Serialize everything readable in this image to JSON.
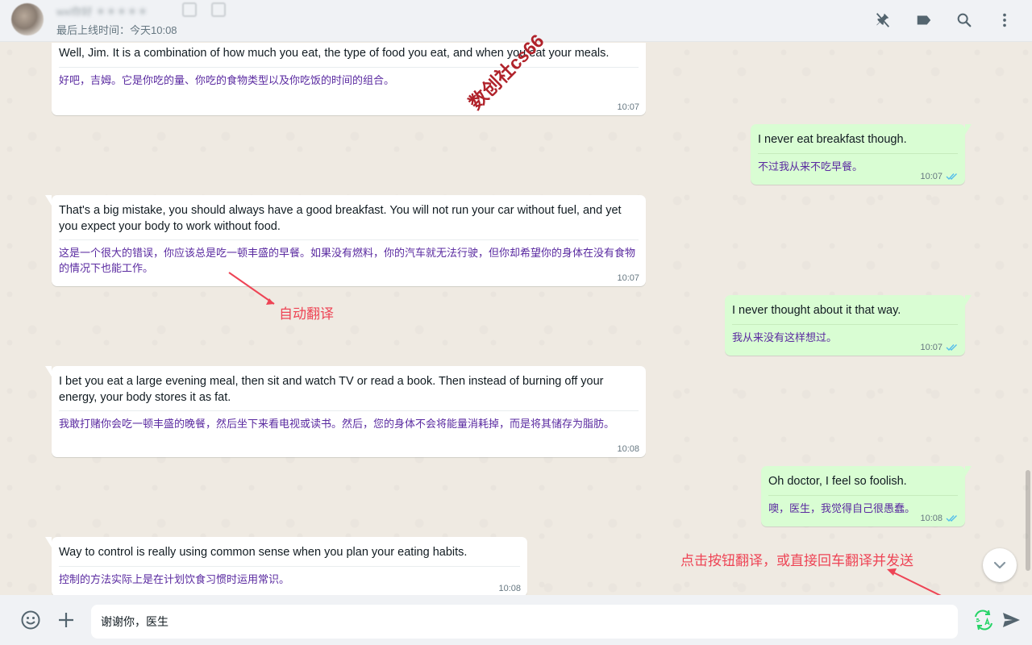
{
  "header": {
    "contact_name": "wxi你好 ＊＊＊＊＊",
    "last_seen": "最后上线时间：今天10:08",
    "icons": [
      "avatar",
      "pin-off-icon",
      "label-icon",
      "search-icon",
      "menu-dots-icon"
    ]
  },
  "messages": [
    {
      "dir": "in",
      "orig": "Well, Jim. It is a combination of how much you eat, the type of food you eat, and when you eat your meals.",
      "trans": "好吧，吉姆。它是你吃的量、你吃的食物类型以及你吃饭的时间的组合。",
      "time": "10:07"
    },
    {
      "dir": "out",
      "orig": "I never eat breakfast though.",
      "trans": "不过我从来不吃早餐。",
      "time": "10:07"
    },
    {
      "dir": "in",
      "orig": "That's a big mistake, you should always have a good breakfast. You will not run your car without fuel, and yet you expect your body to work without food.",
      "trans": "这是一个很大的错误，你应该总是吃一顿丰盛的早餐。如果没有燃料，你的汽车就无法行驶，但你却希望你的身体在没有食物的情况下也能工作。",
      "time": "10:07"
    },
    {
      "dir": "out",
      "orig": "I never thought about it that way.",
      "trans": "我从来没有这样想过。",
      "time": "10:07"
    },
    {
      "dir": "in",
      "orig": "I bet you eat a large evening meal, then sit and watch TV or read a book. Then instead of burning off your energy, your body stores it as fat.",
      "trans": "我敢打赌你会吃一顿丰盛的晚餐，然后坐下来看电视或读书。然后，您的身体不会将能量消耗掉，而是将其储存为脂肪。",
      "time": "10:08"
    },
    {
      "dir": "out",
      "orig": "Oh doctor, I feel so foolish.",
      "trans": "噢，医生，我觉得自己很愚蠢。",
      "time": "10:08"
    },
    {
      "dir": "in",
      "orig": "Way to control is really using common sense when you plan your eating habits.",
      "trans": "控制的方法实际上是在计划饮食习惯时运用常识。",
      "time": "10:08"
    }
  ],
  "annotations": {
    "auto_translate": "自动翻译",
    "click_translate": "点击按钮翻译，或直接回车翻译并发送",
    "watermark": "数创社cs66"
  },
  "footer": {
    "input_value": "谢谢你，医生",
    "icons": [
      "emoji-icon",
      "plus-icon",
      "translate-icon",
      "send-icon"
    ]
  },
  "colors": {
    "incoming_bubble": "#ffffff",
    "outgoing_bubble": "#d9fdd3",
    "translation_text": "#5a2aa0",
    "annotation_red": "#ee4455",
    "translate_green": "#25d366",
    "read_tick": "#53bdeb"
  }
}
